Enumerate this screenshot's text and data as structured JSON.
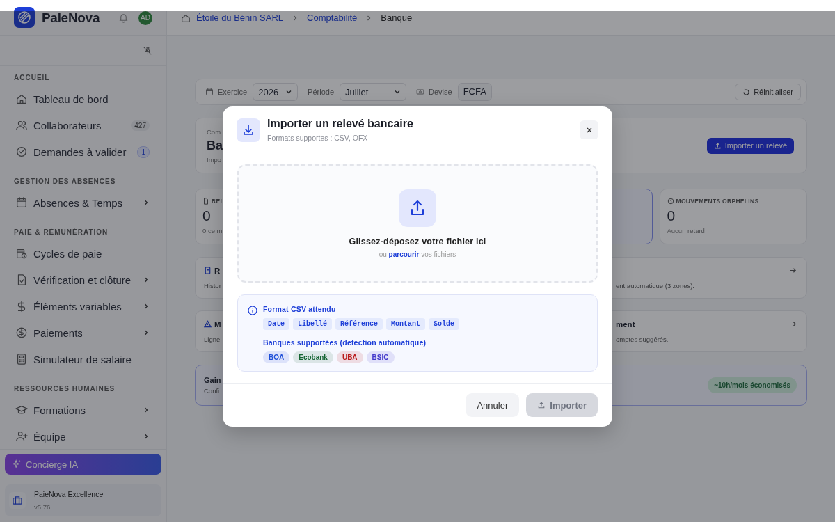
{
  "sidebar": {
    "brand": "PaieNova",
    "avatar": "AD",
    "sections": [
      {
        "title": "ACCUEIL",
        "items": [
          {
            "label": "Tableau de bord",
            "submenu": false
          },
          {
            "label": "Collaborateurs",
            "submenu": false,
            "badge": "427",
            "badge_accent": false
          },
          {
            "label": "Demandes à valider",
            "submenu": false,
            "badge": "1",
            "badge_accent": true
          }
        ]
      },
      {
        "title": "GESTION DES ABSENCES",
        "items": [
          {
            "label": "Absences & Temps",
            "submenu": true
          }
        ]
      },
      {
        "title": "PAIE & RÉMUNÉRATION",
        "items": [
          {
            "label": "Cycles de paie",
            "submenu": false
          },
          {
            "label": "Vérification et clôture",
            "submenu": true
          },
          {
            "label": "Éléments variables",
            "submenu": true
          },
          {
            "label": "Paiements",
            "submenu": true
          },
          {
            "label": "Simulateur de salaire",
            "submenu": false
          }
        ]
      },
      {
        "title": "RESSOURCES HUMAINES",
        "items": [
          {
            "label": "Formations",
            "submenu": true
          },
          {
            "label": "Équipe",
            "submenu": true
          }
        ]
      }
    ],
    "assistant": "Concierge IA",
    "plan": {
      "name": "PaieNova Excellence",
      "version": "v5.76"
    }
  },
  "breadcrumb": [
    {
      "label": "Étoile du Bénin SARL",
      "current": false
    },
    {
      "label": "Comptabilité",
      "current": false
    },
    {
      "label": "Banque",
      "current": true
    }
  ],
  "filters": {
    "exercice_label": "Exercice",
    "exercice": "2026",
    "periode_label": "Période",
    "periode": "Juillet",
    "devise_label": "Devise",
    "devise": "FCFA",
    "reset": "Réinitialiser"
  },
  "header": {
    "eyebrow": "Com",
    "title": "Ba",
    "subtitle": "Impo",
    "action": "Importer un relevé"
  },
  "stats": [
    {
      "label": "REL",
      "value": "0",
      "note": "0 ce m",
      "highlighted": false
    },
    {
      "highlighted": true
    },
    {
      "label": "MOUVEMENTS ORPHELINS",
      "value": "0",
      "note": "Aucun retard",
      "highlighted": false
    }
  ],
  "cards": [
    {
      "title": "R",
      "text": "Histor"
    },
    {
      "text": "ent automatique (3 zones)."
    },
    {
      "title": "M",
      "text": "Ligne"
    },
    {
      "title": "ment",
      "text": "omptes suggérés."
    }
  ],
  "gain": {
    "title": "Gain",
    "text": "Confi",
    "badge": "~10h/mois économisés"
  },
  "modal": {
    "title": "Importer un relevé bancaire",
    "subtitle": "Formats supportes : CSV, OFX",
    "drop_title": "Glissez-déposez votre fichier ici",
    "drop_before": "ou",
    "drop_link": "parcourir",
    "drop_after": "vos fichiers",
    "format_title": "Format CSV attendu",
    "columns": [
      "Date",
      "Libellé",
      "Référence",
      "Montant",
      "Solde"
    ],
    "banks_title": "Banques supportées (detection automatique)",
    "banks": [
      {
        "name": "BOA",
        "color": "#1d4ed8"
      },
      {
        "name": "Ecobank",
        "color": "#166534"
      },
      {
        "name": "UBA",
        "color": "#b91c1c"
      },
      {
        "name": "BSIC",
        "color": "#4338ca"
      }
    ],
    "cancel": "Annuler",
    "submit": {
      "label": "Importer",
      "disabled": true
    }
  }
}
